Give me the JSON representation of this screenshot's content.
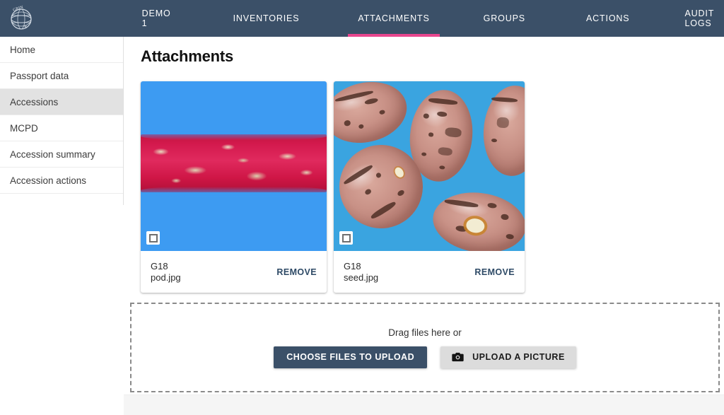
{
  "header": {
    "logo_icon": "grin-globe-logo",
    "brand_color": "#3b5068",
    "accent_color": "#e8468e",
    "tabs": [
      {
        "label": "DEMO 1",
        "active": false
      },
      {
        "label": "INVENTORIES",
        "active": false
      },
      {
        "label": "ATTACHMENTS",
        "active": true
      },
      {
        "label": "GROUPS",
        "active": false
      },
      {
        "label": "ACTIONS",
        "active": false
      },
      {
        "label": "AUDIT LOGS",
        "active": false
      }
    ]
  },
  "sidebar": {
    "items": [
      {
        "label": "Home",
        "selected": false
      },
      {
        "label": "Passport data",
        "selected": false
      },
      {
        "label": "Accessions",
        "selected": true
      },
      {
        "label": "MCPD",
        "selected": false
      },
      {
        "label": "Accession summary",
        "selected": false
      },
      {
        "label": "Accession actions",
        "selected": false
      }
    ]
  },
  "main": {
    "page_title": "Attachments",
    "attachments": [
      {
        "accession": "G18",
        "filename": "pod.jpg",
        "remove_label": "REMOVE",
        "checkbox_icon": "checkbox-unchecked-icon",
        "image_alt": "crimson mottled bean pod on blue background",
        "background_color": "#3d9bf2"
      },
      {
        "accession": "G18",
        "filename": "seed.jpg",
        "remove_label": "REMOVE",
        "checkbox_icon": "checkbox-unchecked-icon",
        "image_alt": "five pinto beans on blue background",
        "background_color": "#3aa4e0"
      }
    ],
    "dropzone": {
      "drag_label": "Drag files here or",
      "choose_files_label": "CHOOSE FILES TO UPLOAD",
      "upload_picture_label": "UPLOAD A PICTURE",
      "camera_icon": "camera-icon"
    }
  }
}
